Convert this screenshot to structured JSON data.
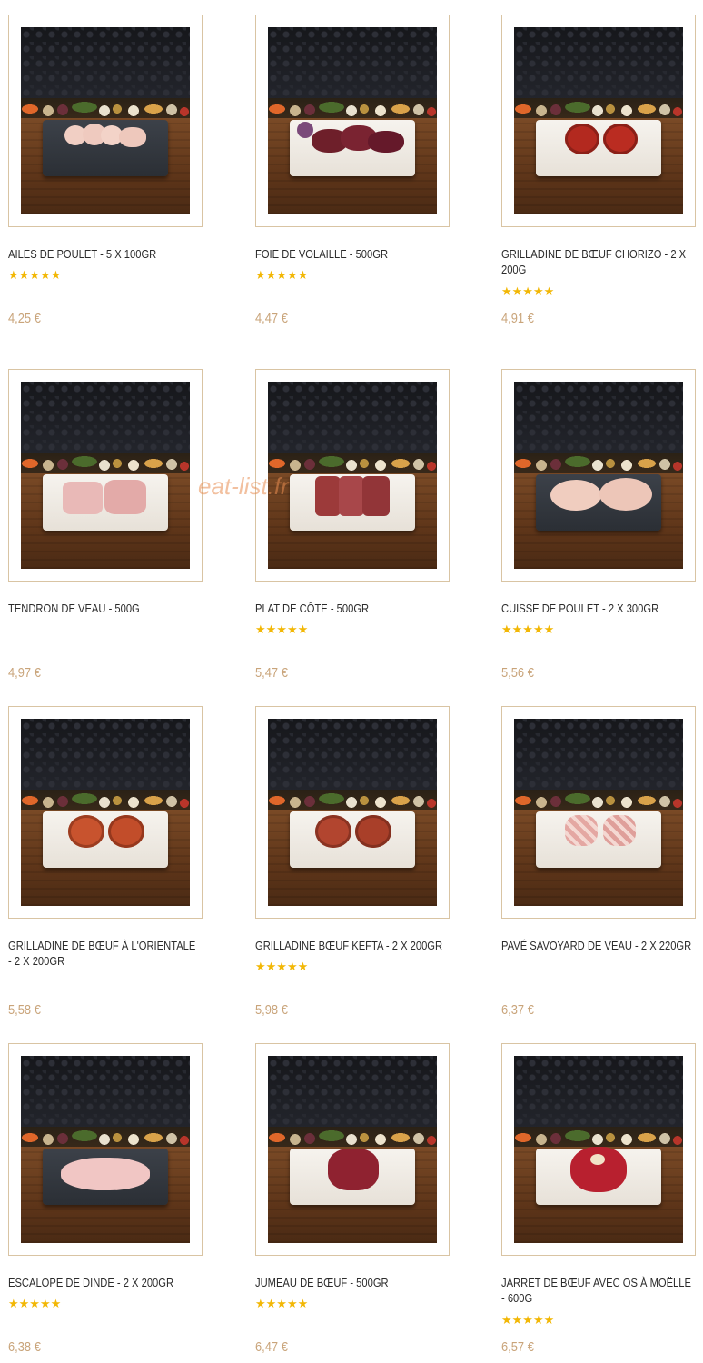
{
  "watermark": "eat-list.fr",
  "products": [
    {
      "name": "AILES DE POULET - 5 X 100GR",
      "rating": 5,
      "stars": "★★★★★",
      "price": "4,25 €",
      "plate": "dark",
      "meat": "chicken-wings"
    },
    {
      "name": "FOIE DE VOLAILLE - 500GR",
      "rating": 5,
      "stars": "★★★★★",
      "price": "4,47 €",
      "plate": "white",
      "meat": "liver"
    },
    {
      "name": "GRILLADINE DE BŒUF CHORIZO - 2 X 200G",
      "rating": 5,
      "stars": "★★★★★",
      "price": "4,91 €",
      "plate": "white",
      "meat": "patties-red"
    },
    {
      "name": "TENDRON DE VEAU - 500G",
      "rating": 0,
      "stars": "",
      "price": "4,97 €",
      "plate": "white",
      "meat": "veal"
    },
    {
      "name": "PLAT DE CÔTE - 500GR",
      "rating": 5,
      "stars": "★★★★★",
      "price": "5,47 €",
      "plate": "white",
      "meat": "ribs"
    },
    {
      "name": "CUISSE DE POULET - 2 X 300GR",
      "rating": 5,
      "stars": "★★★★★",
      "price": "5,56 €",
      "plate": "dark",
      "meat": "chicken-legs"
    },
    {
      "name": "GRILLADINE DE BŒUF À L'ORIENTALE - 2 X 200GR",
      "rating": 0,
      "stars": "",
      "price": "5,58 €",
      "plate": "white",
      "meat": "patties-orange"
    },
    {
      "name": "GRILLADINE BŒUF KEFTA - 2 X 200GR",
      "rating": 5,
      "stars": "★★★★★",
      "price": "5,98 €",
      "plate": "white",
      "meat": "patties-kefta"
    },
    {
      "name": "PAVÉ SAVOYARD DE VEAU - 2 X 220GR",
      "rating": 0,
      "stars": "",
      "price": "6,37 €",
      "plate": "white",
      "meat": "bacon-wrapped"
    },
    {
      "name": "ESCALOPE DE DINDE - 2 X 200GR",
      "rating": 5,
      "stars": "★★★★★",
      "price": "6,38 €",
      "plate": "dark",
      "meat": "turkey"
    },
    {
      "name": "JUMEAU DE BŒUF - 500GR",
      "rating": 5,
      "stars": "★★★★★",
      "price": "6,47 €",
      "plate": "white",
      "meat": "beef-roast"
    },
    {
      "name": "JARRET DE BŒUF AVEC OS À MOËLLE - 600G",
      "rating": 5,
      "stars": "★★★★★",
      "price": "6,57 €",
      "plate": "white",
      "meat": "shank"
    }
  ],
  "colors": {
    "price": "#c9a47a",
    "star": "#f2b705",
    "frame": "#d9c4a3",
    "title": "#2b2b2b"
  }
}
